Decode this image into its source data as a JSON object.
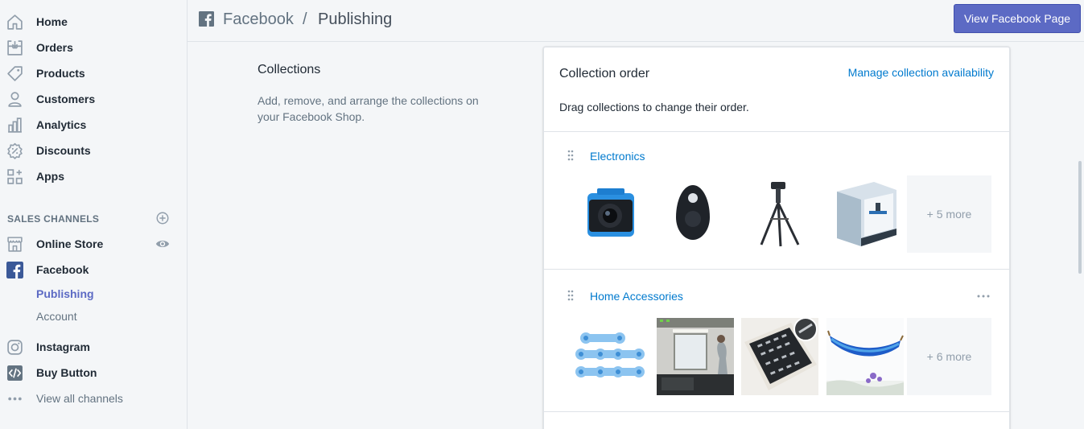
{
  "sidebar": {
    "items": [
      {
        "label": "Home",
        "icon": "home-icon"
      },
      {
        "label": "Orders",
        "icon": "orders-icon"
      },
      {
        "label": "Products",
        "icon": "tag-icon"
      },
      {
        "label": "Customers",
        "icon": "person-icon"
      },
      {
        "label": "Analytics",
        "icon": "bar-chart-icon"
      },
      {
        "label": "Discounts",
        "icon": "discount-icon"
      },
      {
        "label": "Apps",
        "icon": "apps-icon"
      }
    ],
    "section_title": "SALES CHANNELS",
    "channels": [
      {
        "label": "Online Store",
        "icon": "store-icon"
      },
      {
        "label": "Facebook",
        "icon": "facebook-icon"
      }
    ],
    "facebook_sub": [
      {
        "label": "Publishing",
        "active": true
      },
      {
        "label": "Account",
        "active": false
      }
    ],
    "more_channels": [
      {
        "label": "Instagram",
        "icon": "instagram-icon"
      },
      {
        "label": "Buy Button",
        "icon": "code-icon"
      }
    ],
    "view_all": "View all channels"
  },
  "header": {
    "breadcrumb_parent": "Facebook",
    "separator": "/",
    "breadcrumb_current": "Publishing",
    "primary_button": "View Facebook Page"
  },
  "section": {
    "title": "Collections",
    "description": "Add, remove, and arrange the collections on your Facebook Shop."
  },
  "card": {
    "title": "Collection order",
    "link": "Manage collection availability",
    "subtitle": "Drag collections to change their order.",
    "collections": [
      {
        "name": "Electronics",
        "more": "+ 5 more"
      },
      {
        "name": "Home Accessories",
        "more": "+ 6 more"
      }
    ]
  },
  "colors": {
    "accent": "#5c6ac4",
    "link": "#007ace",
    "facebook": "#3b5998"
  }
}
